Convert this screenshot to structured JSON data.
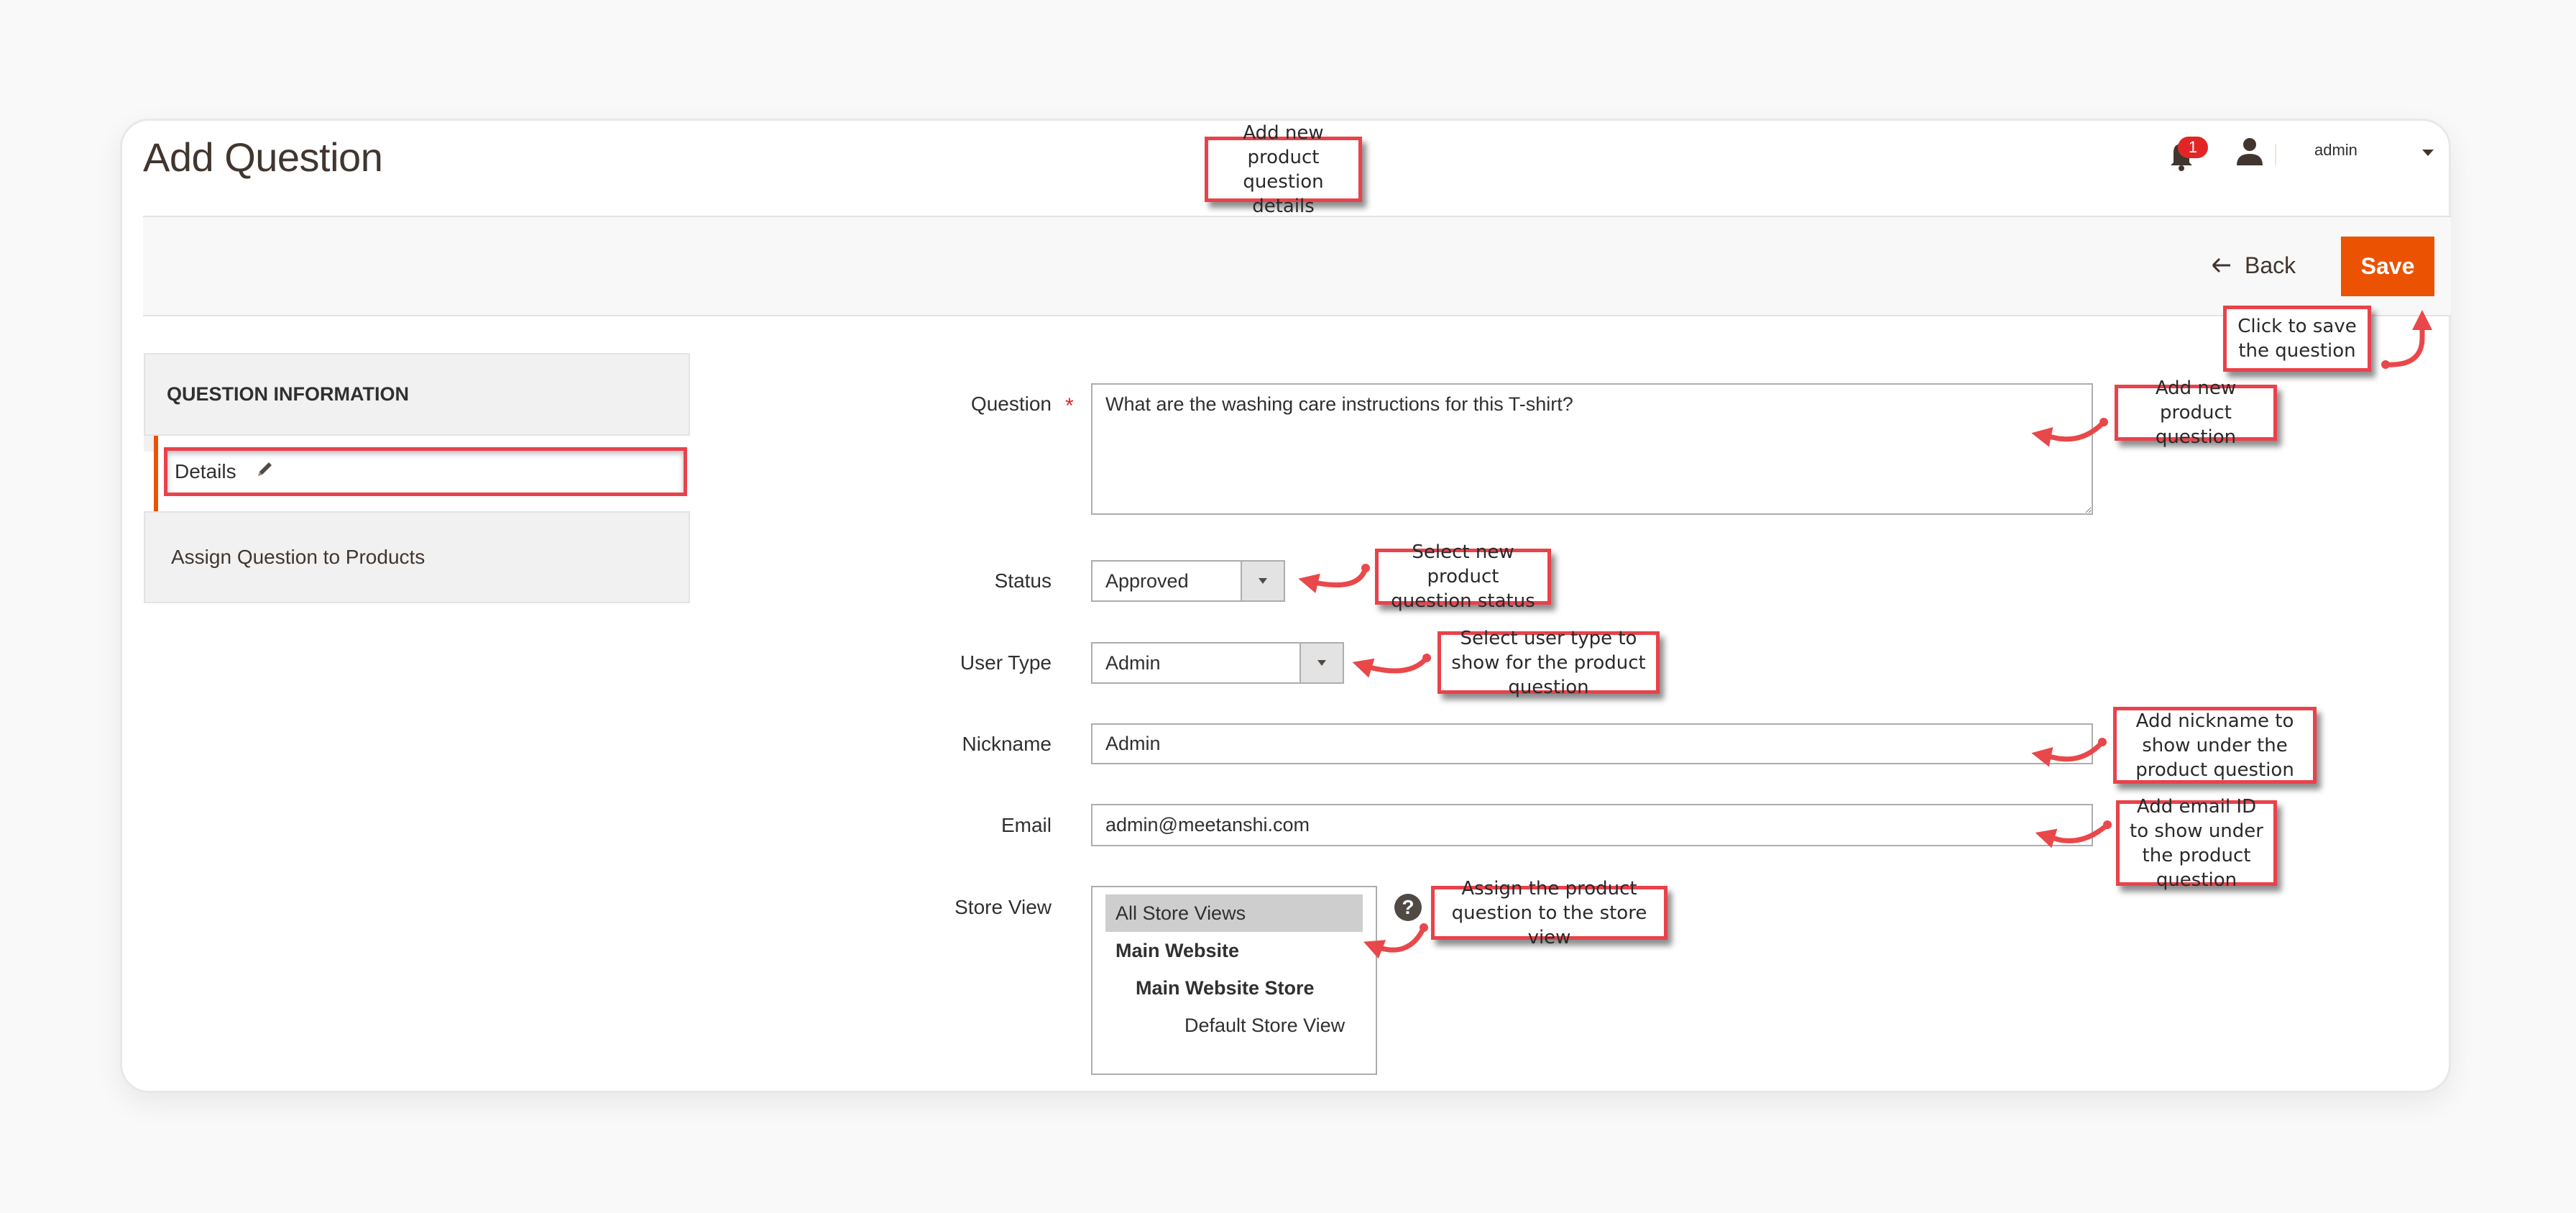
{
  "page": {
    "title": "Add Question"
  },
  "header": {
    "notification_count": "1",
    "username": "admin"
  },
  "actions": {
    "back_label": "Back",
    "save_label": "Save"
  },
  "sidebar": {
    "section_title": "QUESTION INFORMATION",
    "items": [
      {
        "label": "Details",
        "active": true
      },
      {
        "label": "Assign Question to Products",
        "active": false
      }
    ]
  },
  "form": {
    "question": {
      "label": "Question",
      "required_mark": "*",
      "value": "What are the washing care instructions for this T-shirt?"
    },
    "status": {
      "label": "Status",
      "value": "Approved"
    },
    "user_type": {
      "label": "User Type",
      "value": "Admin"
    },
    "nickname": {
      "label": "Nickname",
      "value": "Admin"
    },
    "email": {
      "label": "Email",
      "value": "admin@meetanshi.com"
    },
    "store_view": {
      "label": "Store View",
      "options": [
        {
          "label": "All Store Views",
          "selected": true
        },
        {
          "label": "Main Website",
          "selected": false
        },
        {
          "label": "Main Website Store",
          "selected": false
        },
        {
          "label": "Default Store View",
          "selected": false
        }
      ],
      "help": "?"
    }
  },
  "annotations": {
    "page_details": "Add new product question details",
    "save": "Click to save the question",
    "question": "Add new product question",
    "status": "Select new product question status",
    "user_type": "Select user type to show for the product question",
    "nickname": "Add nickname to show under the product question",
    "email": "Add email ID to show under the product question",
    "store_view": "Assign the product question to the store view"
  },
  "colors": {
    "accent": "#eb5202",
    "annotation_border": "#e9424b",
    "badge": "#e22626"
  }
}
